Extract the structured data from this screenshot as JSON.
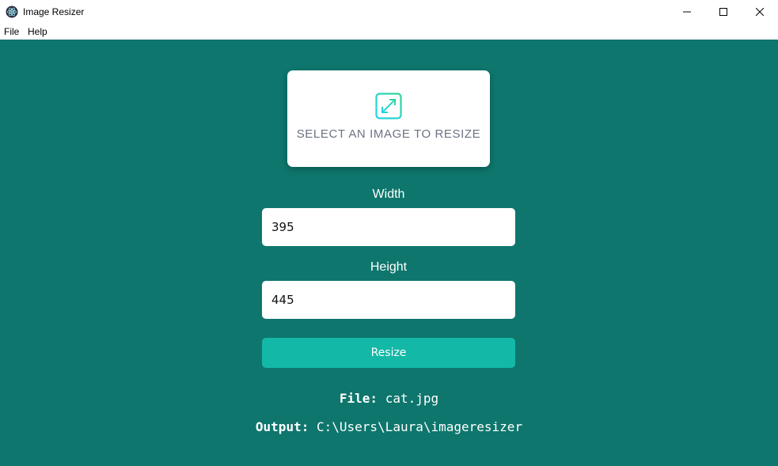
{
  "window": {
    "title": "Image Resizer",
    "icon": "electron-atom-icon",
    "controls": {
      "minimize": "minimize-icon",
      "maximize": "maximize-icon",
      "close": "close-icon"
    }
  },
  "menu": {
    "items": [
      {
        "label": "File"
      },
      {
        "label": "Help"
      }
    ]
  },
  "select_card": {
    "label": "SELECT AN IMAGE TO RESIZE",
    "icon": "expand-arrows-icon"
  },
  "form": {
    "width_label": "Width",
    "width_value": "395",
    "height_label": "Height",
    "height_value": "445",
    "resize_label": "Resize"
  },
  "info": {
    "file_label": "File:",
    "file_value": "cat.jpg",
    "output_label": "Output:",
    "output_value": "C:\\Users\\Laura\\imageresizer"
  },
  "colors": {
    "background": "#0e766d",
    "accent": "#14b8a6",
    "card": "#ffffff"
  }
}
